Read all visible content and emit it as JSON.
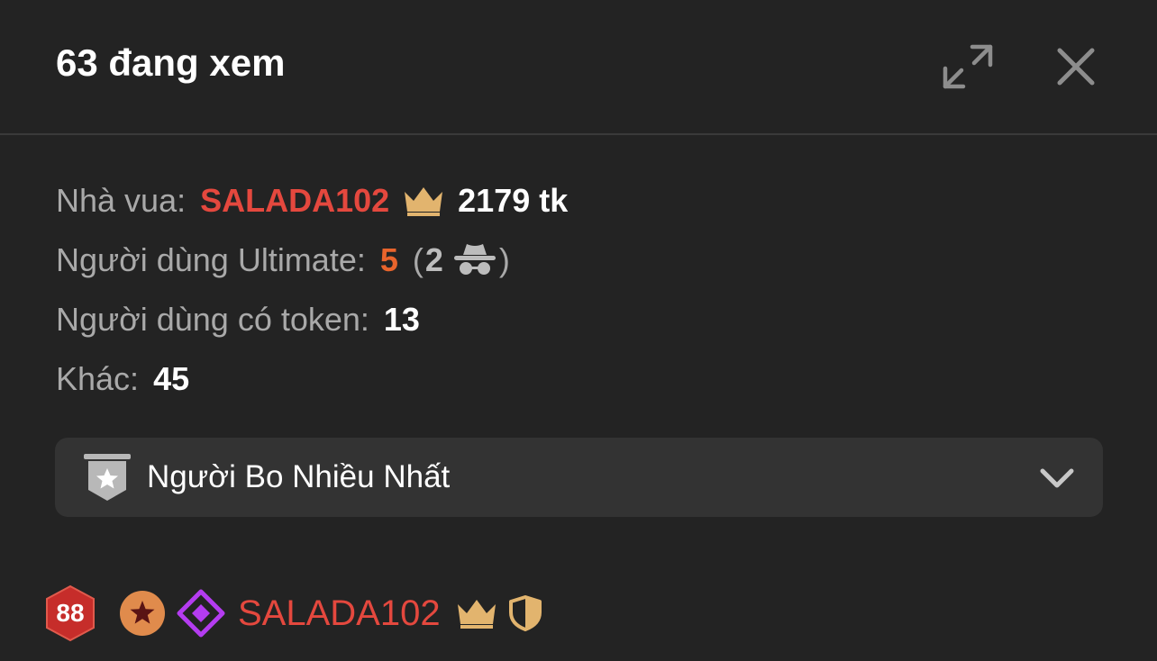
{
  "header": {
    "title": "63 đang xem"
  },
  "stats": {
    "king_label": "Nhà vua:",
    "king_name": "SALADA102",
    "king_tokens": "2179 tk",
    "ultimate_label": "Người dùng Ultimate:",
    "ultimate_count": "5",
    "paren_open": "(",
    "anonymous_count": "2",
    "paren_close": ")",
    "token_users_label": "Người dùng có token:",
    "token_users_count": "13",
    "other_label": "Khác:",
    "other_count": "45"
  },
  "dropdown": {
    "label": "Người Bo Nhiều Nhất"
  },
  "top_user": {
    "level": "88",
    "name": "SALADA102"
  },
  "colors": {
    "background": "#232323",
    "king_red": "#e4483e",
    "ultimate_orange": "#e8642c",
    "crown_gold": "#e2b46e",
    "diamond_purple": "#b43cf0",
    "dropdown_bg": "#333333"
  },
  "icons": {
    "expand": "expand-icon",
    "close": "close-icon",
    "crown": "crown-icon",
    "anonymous": "spy-icon",
    "dropdown_badge": "star-shield-icon",
    "chevron": "chevron-down-icon",
    "level": "level-hexagon-icon",
    "fan_club": "star-circle-icon",
    "diamond": "diamond-icon",
    "shield": "shield-icon"
  }
}
